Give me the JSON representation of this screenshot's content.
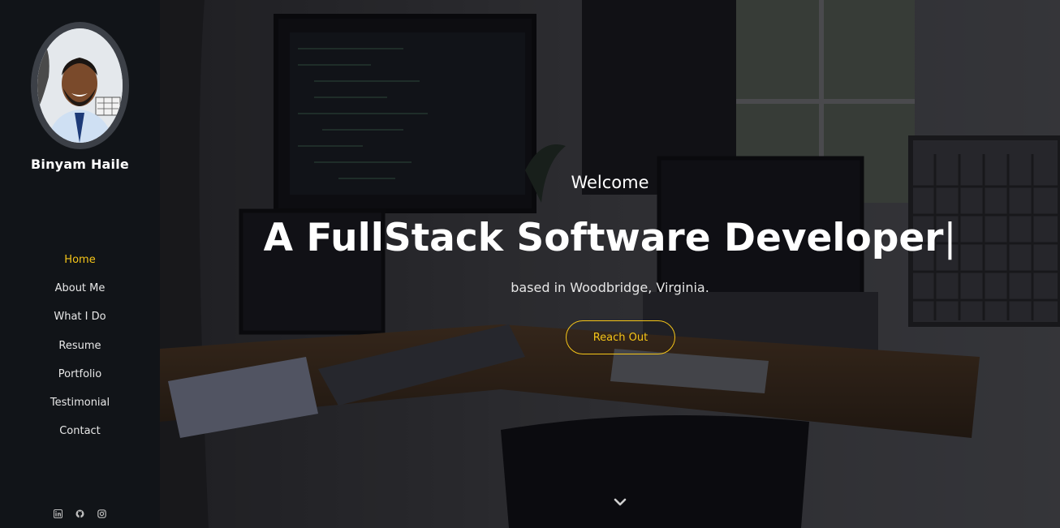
{
  "sidebar": {
    "name": "Binyam Haile",
    "nav": [
      {
        "label": "Home",
        "active": true
      },
      {
        "label": "About Me"
      },
      {
        "label": "What I Do"
      },
      {
        "label": "Resume"
      },
      {
        "label": "Portfolio"
      },
      {
        "label": "Testimonial"
      },
      {
        "label": "Contact"
      }
    ],
    "social_icons": [
      "linkedin-icon",
      "github-icon",
      "instagram-icon"
    ]
  },
  "hero": {
    "welcome": "Welcome",
    "headline": "A FullStack Software Developer",
    "cursor": "|",
    "subline": "based in Woodbridge, Virginia.",
    "cta_label": "Reach Out",
    "scroll_icon": "chevron-down-icon"
  },
  "colors": {
    "accent": "#f5c518",
    "sidebar_bg": "#111418",
    "text": "#ffffff"
  }
}
